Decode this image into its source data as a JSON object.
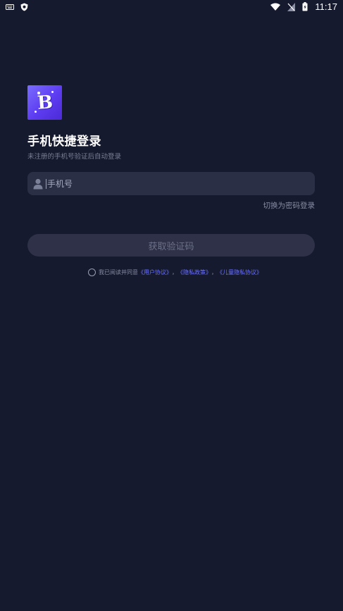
{
  "status_bar": {
    "time": "11:17",
    "left_icons": [
      "keyboard-icon",
      "shield-icon"
    ],
    "right_icons": [
      "wifi-icon",
      "no-signal-icon",
      "battery-icon"
    ]
  },
  "login": {
    "title": "手机快捷登录",
    "subtitle": "未注册的手机号验证后自动登录",
    "phone_placeholder": "手机号",
    "switch_label": "切换为密码登录",
    "get_code_label": "获取验证码"
  },
  "agreement": {
    "prefix": "我已阅读并同意",
    "user_agreement": "《用户协议》",
    "sep1": "，",
    "privacy_policy": "《隐私政策》",
    "sep2": "，",
    "children_privacy": "《儿童隐私协议》"
  },
  "colors": {
    "background": "#161a2e",
    "field": "#2b2f45",
    "link": "#6b72ff",
    "logo_gradient": [
      "#7a6cff",
      "#4b2ad8"
    ]
  }
}
